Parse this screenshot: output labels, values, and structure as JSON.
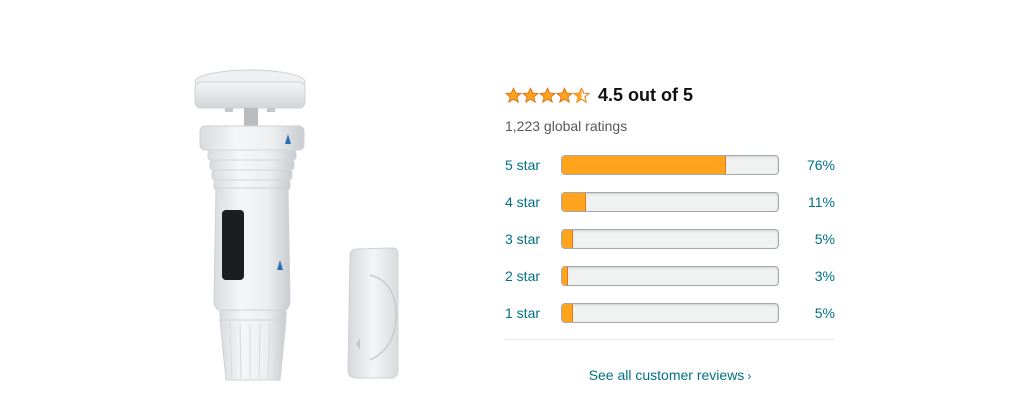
{
  "rating_summary": {
    "average_rating": 4.5,
    "average_text": "4.5 out of 5",
    "global_ratings_text": "1,223 global ratings",
    "stars": [
      "full",
      "full",
      "full",
      "full",
      "half"
    ]
  },
  "histogram": [
    {
      "label": "5 star",
      "percent_text": "76%",
      "percent": 76
    },
    {
      "label": "4 star",
      "percent_text": "11%",
      "percent": 11
    },
    {
      "label": "3 star",
      "percent_text": "5%",
      "percent": 5
    },
    {
      "label": "2 star",
      "percent_text": "3%",
      "percent": 3
    },
    {
      "label": "1 star",
      "percent_text": "5%",
      "percent": 5
    }
  ],
  "see_all": {
    "label": "See all customer reviews",
    "chevron": "›"
  },
  "colors": {
    "star_fill": "#ffa41c",
    "star_stroke": "#de7921",
    "link": "#007185",
    "bar_track": "#f0f2f2"
  },
  "product_image": {
    "icons": [
      "weather-sensor-icon",
      "repeater-icon"
    ]
  }
}
